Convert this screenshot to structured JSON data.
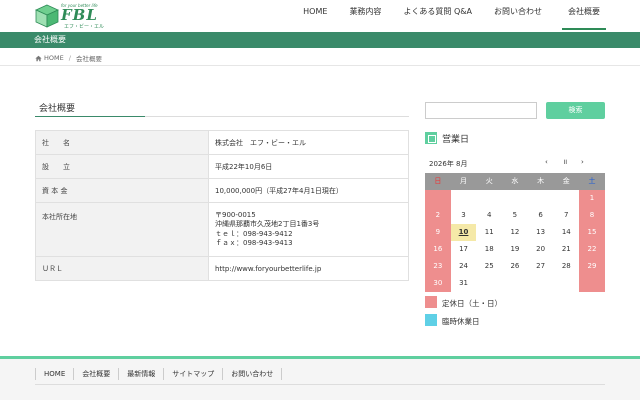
{
  "header": {
    "logo": {
      "tagline": "for your better life",
      "main": "FBL",
      "sub": "エフ・ビー・エル"
    },
    "nav": [
      {
        "label": "HOME"
      },
      {
        "label": "業務内容"
      },
      {
        "label": "よくある質問 Q&A"
      },
      {
        "label": "お問い合わせ"
      },
      {
        "label": "会社概要"
      }
    ]
  },
  "page_title": "会社概要",
  "breadcrumb": {
    "home": "HOME",
    "separator": "/",
    "current": "会社概要"
  },
  "main": {
    "heading": "会社概要",
    "table": [
      {
        "label": "社　　名",
        "value": "株式会社　エフ・ビー・エル"
      },
      {
        "label": "設　　立",
        "value": "平成22年10月6日"
      },
      {
        "label": "資 本 金",
        "value": "10,000,000円（平成27年4月1日現在）"
      },
      {
        "label": "本社所在地",
        "lines": [
          "〒900-0015",
          "沖縄県那覇市久茂地2丁目1番3号",
          "ｔｅｌ：098-943-9412",
          "ｆａｘ：098-943-9413"
        ]
      },
      {
        "label": "ＵＲＬ",
        "value": "http://www.foryourbetterlife.jp"
      }
    ]
  },
  "sidebar": {
    "search": {
      "placeholder": "",
      "button": "検索"
    },
    "calendar": {
      "title": "営業日",
      "month_label": "2026年 8月",
      "nav": {
        "prev": "‹",
        "pause": "॥",
        "next": "›"
      },
      "weekdays": [
        "日",
        "月",
        "火",
        "水",
        "木",
        "金",
        "土"
      ],
      "weeks": [
        [
          "",
          "",
          "",
          "",
          "",
          "",
          "1"
        ],
        [
          "2",
          "3",
          "4",
          "5",
          "6",
          "7",
          "8"
        ],
        [
          "9",
          "10",
          "11",
          "12",
          "13",
          "14",
          "15"
        ],
        [
          "16",
          "17",
          "18",
          "19",
          "20",
          "21",
          "22"
        ],
        [
          "23",
          "24",
          "25",
          "26",
          "27",
          "28",
          "29"
        ],
        [
          "30",
          "31",
          "",
          "",
          "",
          "",
          ""
        ]
      ],
      "today": "10",
      "legend": [
        {
          "label": "定休日（土・日）",
          "color": "#ee8e8e"
        },
        {
          "label": "臨時休業日",
          "color": "#5fd0e6"
        }
      ]
    }
  },
  "footer": {
    "nav": [
      {
        "label": "HOME"
      },
      {
        "label": "会社概要"
      },
      {
        "label": "最新情報"
      },
      {
        "label": "サイトマップ"
      },
      {
        "label": "お問い合わせ"
      }
    ]
  },
  "colors": {
    "brand": "#2e8b57",
    "bar": "#3a8a6a",
    "accent": "#5fcf9f",
    "closed": "#ee8e8e",
    "temp_closed": "#5fd0e6"
  }
}
